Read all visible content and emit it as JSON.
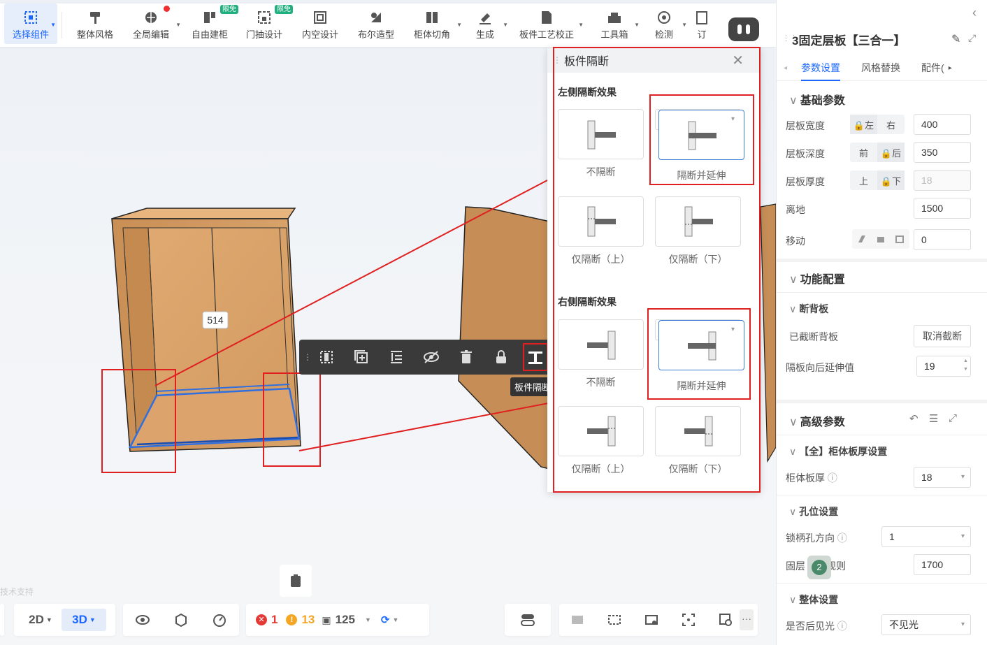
{
  "toolbar": {
    "items": [
      {
        "label": "选择组件",
        "icon": "select-component-icon"
      },
      {
        "label": "整体风格",
        "icon": "paint-roller-icon"
      },
      {
        "label": "全局编辑",
        "icon": "globe-edit-icon"
      },
      {
        "label": "自由建柜",
        "icon": "cabinet-build-icon",
        "badge": "限免"
      },
      {
        "label": "门抽设计",
        "icon": "door-drawer-icon",
        "badge": "限免"
      },
      {
        "label": "内空设计",
        "icon": "interior-space-icon"
      },
      {
        "label": "布尔造型",
        "icon": "boolean-shape-icon"
      },
      {
        "label": "柜体切角",
        "icon": "cabinet-chamfer-icon"
      },
      {
        "label": "生成",
        "icon": "generate-icon"
      },
      {
        "label": "板件工艺校正",
        "icon": "panel-process-icon"
      },
      {
        "label": "工具箱",
        "icon": "toolbox-icon"
      },
      {
        "label": "检测",
        "icon": "detect-icon"
      },
      {
        "label": "订",
        "icon": "order-icon"
      }
    ]
  },
  "viewport": {
    "dimension_label": "514",
    "context_toolbar_tooltip": "板件隔断",
    "watermark": "技术支持"
  },
  "popup": {
    "title": "板件隔断",
    "left_section": "左侧隔断效果",
    "right_section": "右侧隔断效果",
    "left_options": [
      "不隔断",
      "隔断并延伸",
      "仅隔断（上）",
      "仅隔断（下）"
    ],
    "right_options": [
      "不隔断",
      "隔断并延伸",
      "仅隔断（上）",
      "仅隔断（下）"
    ],
    "left_selected": 1,
    "right_selected": 1
  },
  "panel": {
    "title": "3固定层板【三合一】",
    "tabs": [
      "参数设置",
      "风格替换",
      "配件("
    ],
    "basic": {
      "heading": "基础参数",
      "rows": [
        {
          "label": "层板宽度",
          "seg": [
            "🔒左",
            "右"
          ],
          "value": "400"
        },
        {
          "label": "层板深度",
          "seg": [
            "前",
            "🔒后"
          ],
          "value": "350"
        },
        {
          "label": "层板厚度",
          "seg": [
            "上",
            "🔒下"
          ],
          "value": "18"
        },
        {
          "label": "离地",
          "value": "1500"
        },
        {
          "label": "移动",
          "value": "0"
        }
      ]
    },
    "function": {
      "heading": "功能配置",
      "sub": "断背板",
      "cut_label": "已截断背板",
      "cut_button": "取消截断",
      "extend_label": "隔板向后延伸值",
      "extend_value": "19"
    },
    "advanced": {
      "heading": "高级参数",
      "thick_heading": "【全】柜体板厚设置",
      "thick_label": "柜体板厚",
      "thick_value": "18",
      "hole_heading": "孔位设置",
      "lock_label": "锁柄孔方向",
      "lock_value": "1",
      "rule_label": "固层",
      "rule_label2": "规则",
      "rule_badge": "2",
      "rule_value": "1700",
      "overall_heading": "整体设置",
      "back_label": "是否后见光",
      "back_value": "不见光"
    }
  },
  "bottom": {
    "view2d": "2D",
    "view3d": "3D",
    "errors": "1",
    "warnings": "13",
    "count": "125"
  },
  "colors": {
    "accent": "#1a66ff",
    "highlight": "#e02020",
    "wood": "#d9a36a",
    "selection": "#2f6fe0"
  }
}
